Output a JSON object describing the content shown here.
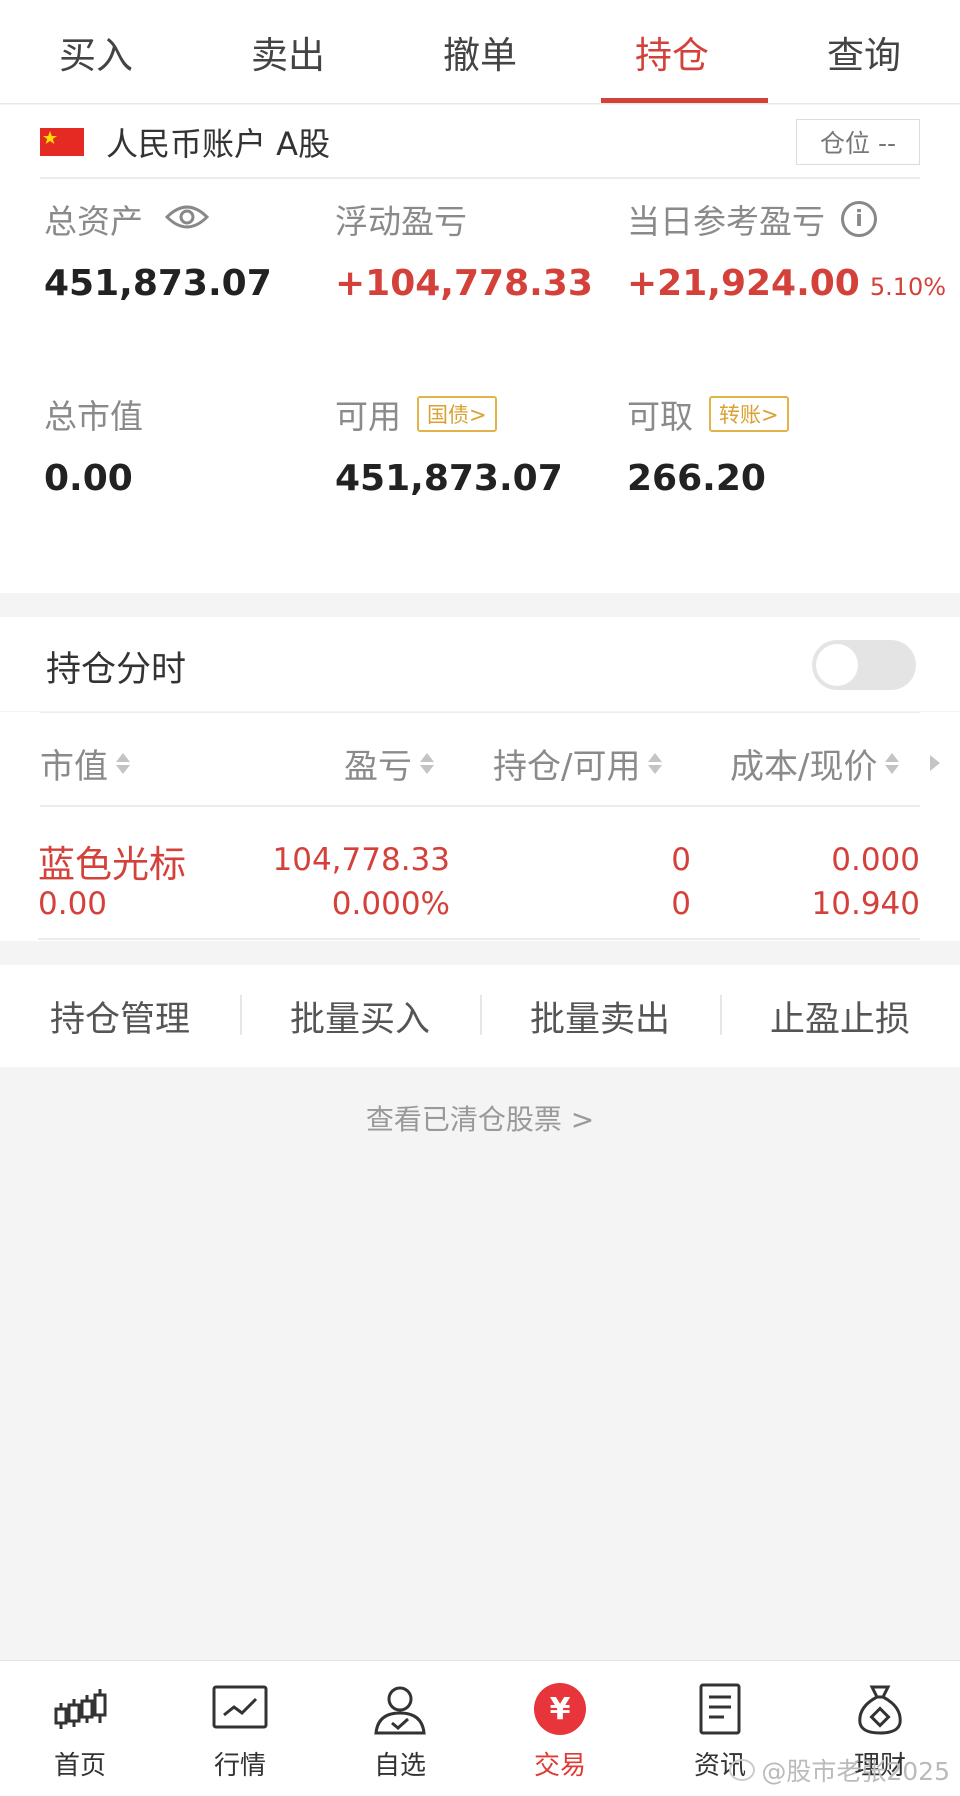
{
  "tabs": [
    {
      "label": "买入",
      "active": false
    },
    {
      "label": "卖出",
      "active": false
    },
    {
      "label": "撤单",
      "active": false
    },
    {
      "label": "持仓",
      "active": true
    },
    {
      "label": "查询",
      "active": false
    }
  ],
  "account": {
    "flag": "china-flag",
    "name": "人民币账户 A股",
    "position_button": "仓位 --"
  },
  "metrics": {
    "total_assets": {
      "label": "总资产",
      "value": "451,873.07"
    },
    "floating_pnl": {
      "label": "浮动盈亏",
      "value": "+104,778.33"
    },
    "daily_pnl": {
      "label": "当日参考盈亏",
      "value": "+21,924.00",
      "pct": "5.10%"
    },
    "market_value": {
      "label": "总市值",
      "value": "0.00"
    },
    "available": {
      "label": "可用",
      "value": "451,873.07",
      "tag": "国债>"
    },
    "withdrawable": {
      "label": "可取",
      "value": "266.20",
      "tag": "转账>"
    }
  },
  "timeline": {
    "title": "持仓分时",
    "toggle_on": false
  },
  "table": {
    "headers": [
      "市值",
      "盈亏",
      "持仓/可用",
      "成本/现价"
    ],
    "rows": [
      {
        "name": "蓝色光标",
        "market_value": "0.00",
        "pnl": "104,778.33",
        "pnl_pct": "0.000%",
        "position": "0",
        "available": "0",
        "cost": "0.000",
        "price": "10.940"
      }
    ]
  },
  "actions": [
    "持仓管理",
    "批量买入",
    "批量卖出",
    "止盈止损"
  ],
  "cleared_link": "查看已清仓股票 >",
  "bottom_nav": [
    {
      "label": "首页",
      "icon": "candlestick-icon",
      "active": false
    },
    {
      "label": "行情",
      "icon": "chart-icon",
      "active": false
    },
    {
      "label": "自选",
      "icon": "user-check-icon",
      "active": false
    },
    {
      "label": "交易",
      "icon": "yen-icon",
      "active": true
    },
    {
      "label": "资讯",
      "icon": "document-icon",
      "active": false
    },
    {
      "label": "理财",
      "icon": "money-bag-icon",
      "active": false
    }
  ],
  "watermark": "@股市老张2025",
  "colors": {
    "accent_red": "#d3413a",
    "tag_gold": "#d9a233",
    "background": "#f4f4f4"
  }
}
